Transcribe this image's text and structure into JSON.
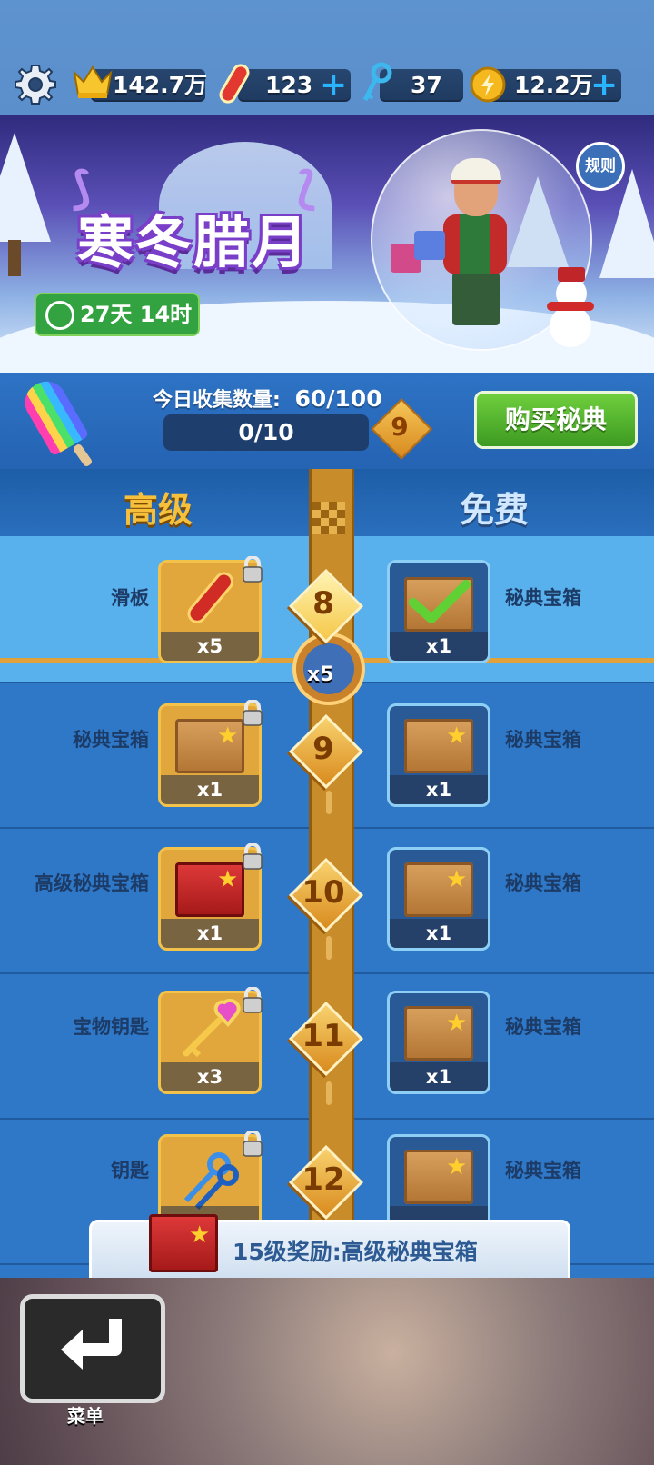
{
  "topbar": {
    "crowns": "142.7万",
    "boards": "123",
    "keys": "37",
    "coins": "12.2万",
    "plus": "+"
  },
  "banner": {
    "title": "寒冬腊月",
    "timer": "27天 14时",
    "rules_label": "规则"
  },
  "collect": {
    "today_label": "今日收集数量:",
    "today_value": "60/100",
    "progress_text": "0/10",
    "current_level": "9",
    "buy_label": "购买秘典"
  },
  "columns": {
    "premium_title": "高级",
    "free_title": "免费"
  },
  "rows": [
    {
      "level": "8",
      "premium_name": "滑板",
      "premium_qty": "x5",
      "free_name": "秘典宝箱",
      "free_qty": "x1"
    },
    {
      "level": "9",
      "premium_name": "秘典宝箱",
      "premium_qty": "x1",
      "free_name": "秘典宝箱",
      "free_qty": "x1"
    },
    {
      "level": "10",
      "premium_name": "高级秘典宝箱",
      "premium_qty": "x1",
      "free_name": "秘典宝箱",
      "free_qty": "x1"
    },
    {
      "level": "11",
      "premium_name": "宝物钥匙",
      "premium_qty": "x3",
      "free_name": "秘典宝箱",
      "free_qty": "x1"
    },
    {
      "level": "12",
      "premium_name": "钥匙",
      "premium_qty": "",
      "free_name": "秘典宝箱",
      "free_qty": ""
    }
  ],
  "key_milestone": "x5",
  "reward_banner": "15级奖励:高级秘典宝箱",
  "menu_label": "菜单",
  "colors": {
    "accent_gold": "#f3c24a",
    "free_border": "#8ed0f5",
    "buy_green": "#4cae2c"
  }
}
